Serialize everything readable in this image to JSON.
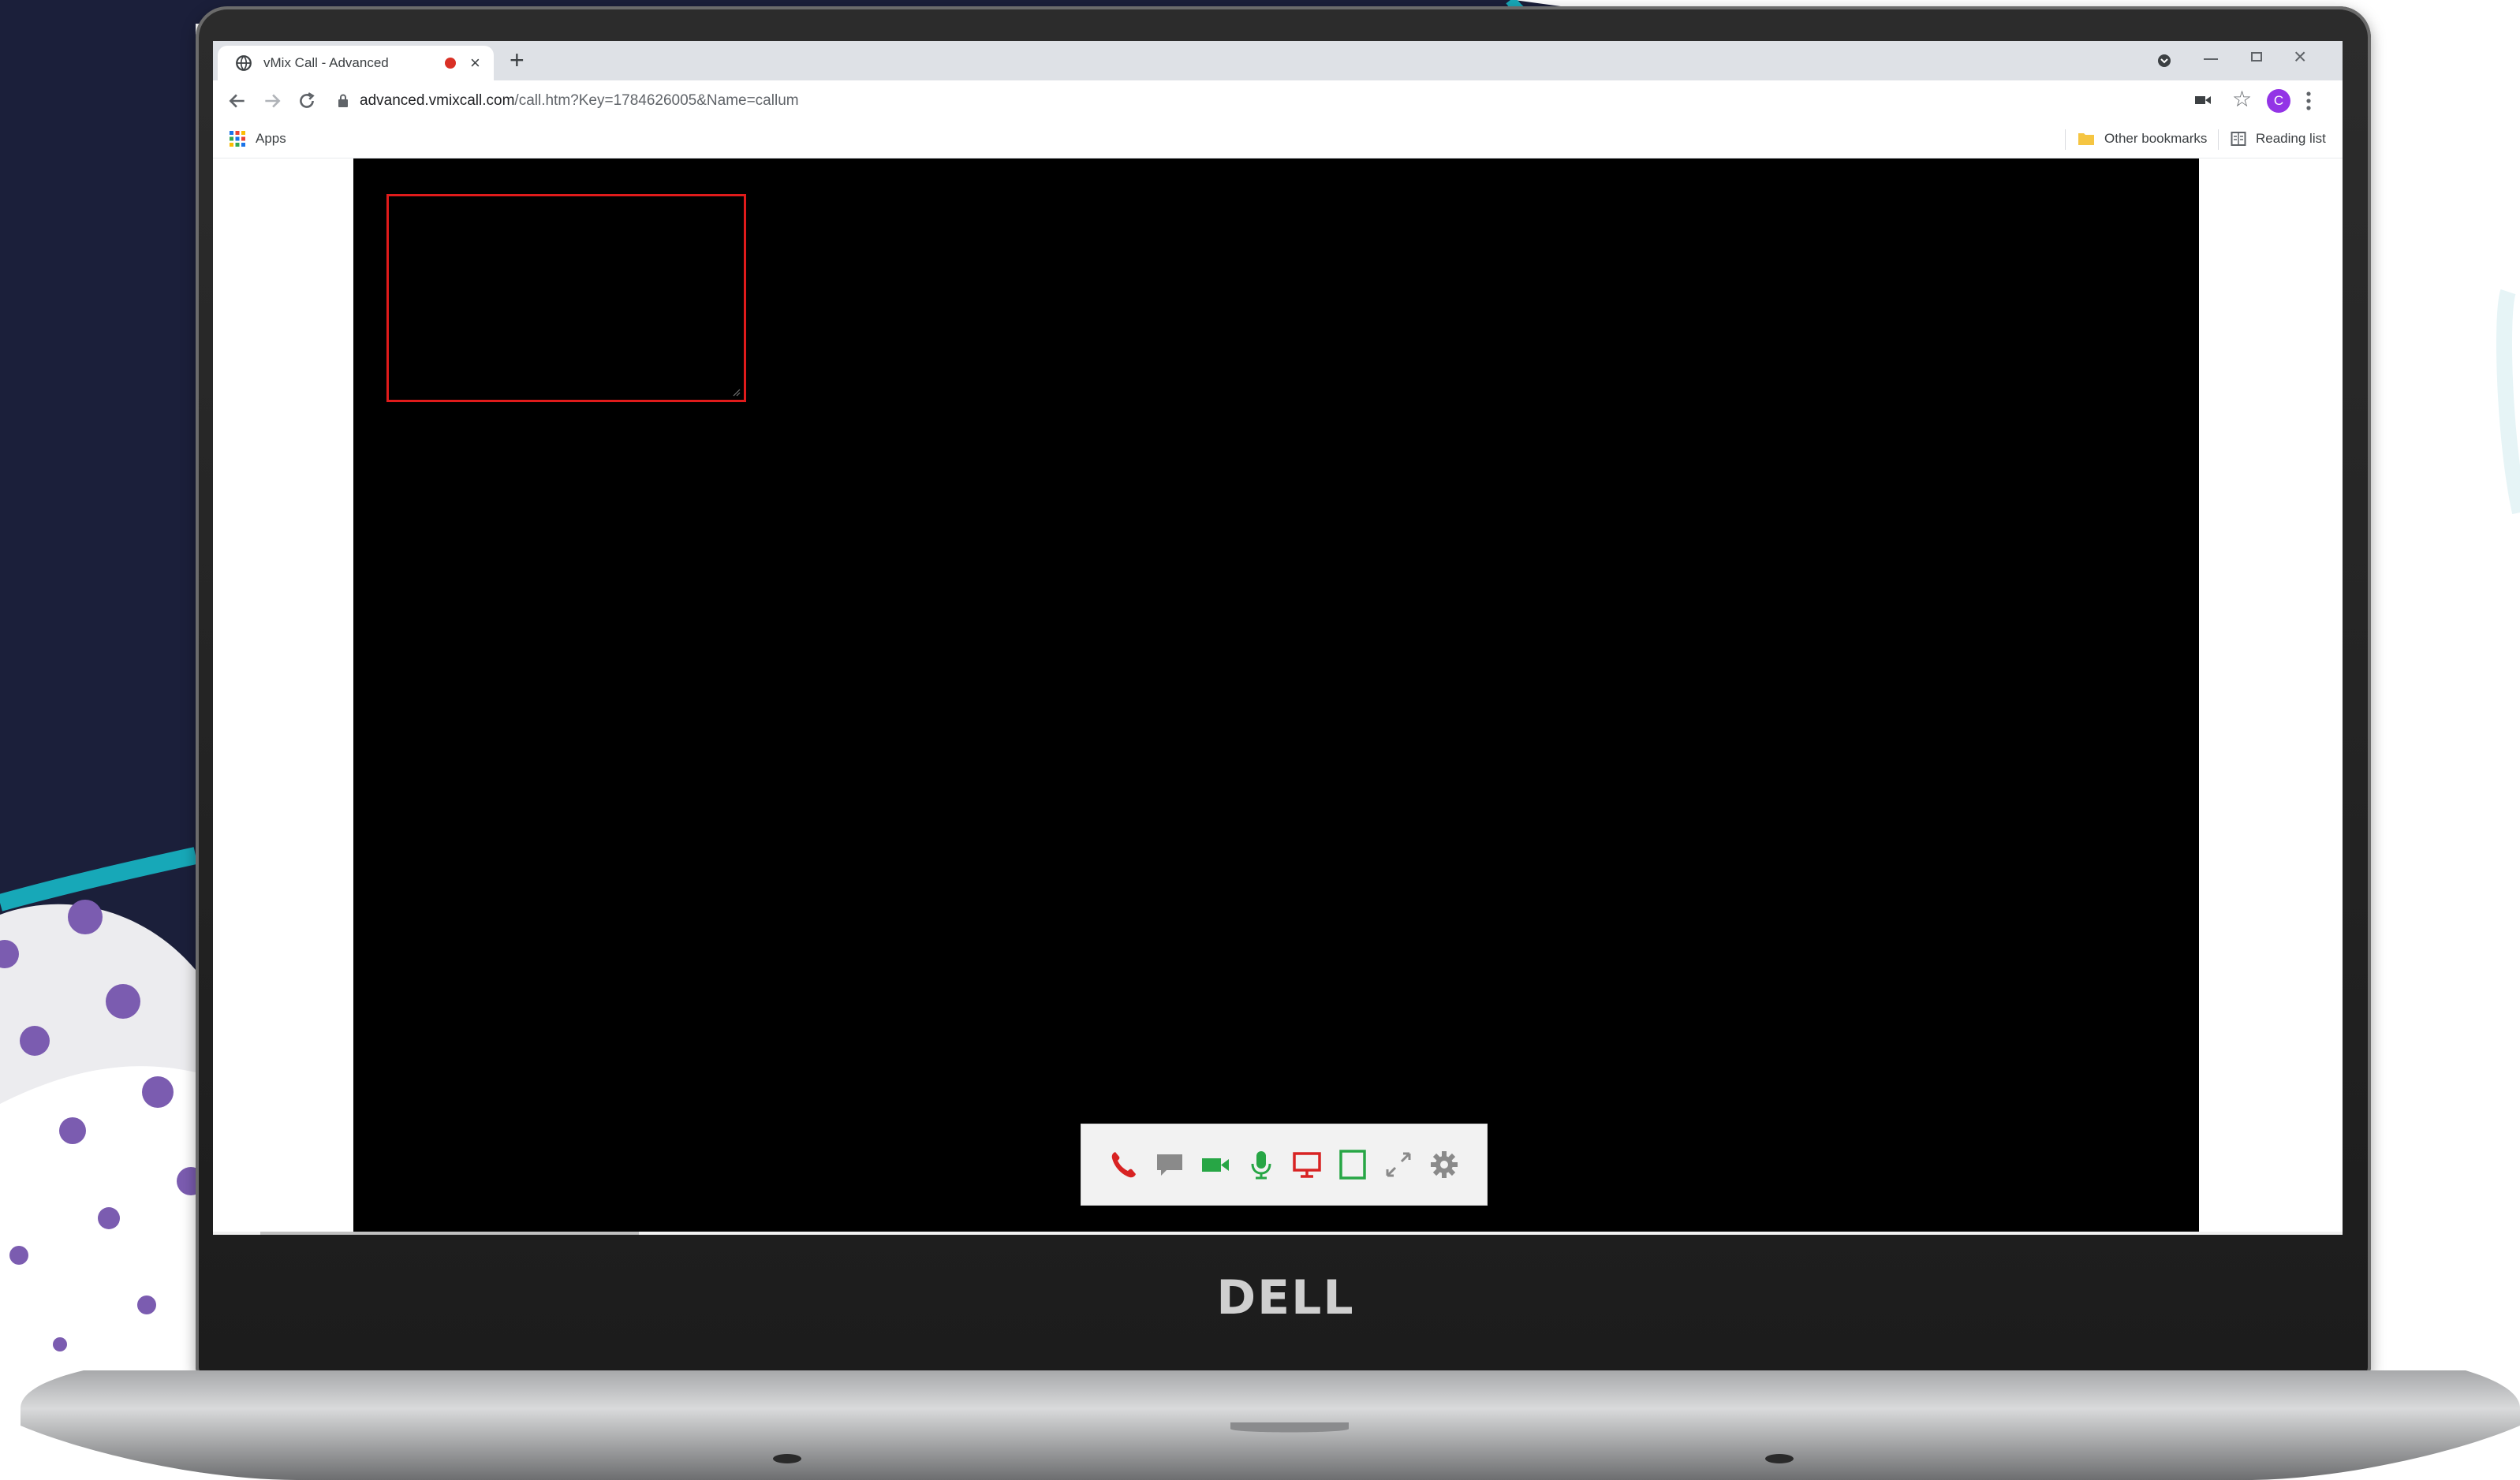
{
  "colors": {
    "background_navy": "#1b1f3a",
    "accent_teal": "#17a8b8",
    "dots_purple": "#7b5cb0",
    "preview_border": "#e01b1b",
    "hangup_red": "#d82323",
    "active_green": "#27a645",
    "screenshare_red": "#d82323",
    "muted_gray": "#8a8a8a"
  },
  "browser": {
    "tab": {
      "title": "vMix Call - Advanced",
      "favicon": "globe-icon",
      "recording_indicator": "record-icon",
      "close_icon": "close-icon"
    },
    "new_tab_icon": "plus-icon",
    "address": {
      "host": "advanced.vmixcall.com",
      "path": "/call.htm?Key=1784626005&Name=callum"
    },
    "profile_initial": "C",
    "bookmarks": {
      "apps_label": "Apps",
      "other_label": "Other bookmarks",
      "reading_label": "Reading list"
    }
  },
  "call": {
    "controls": [
      {
        "name": "hangup-icon",
        "state": "red"
      },
      {
        "name": "chat-icon",
        "state": "gray"
      },
      {
        "name": "camera-icon",
        "state": "green"
      },
      {
        "name": "microphone-icon",
        "state": "green"
      },
      {
        "name": "screen-share-icon",
        "state": "red"
      },
      {
        "name": "layout-icon",
        "state": "green"
      },
      {
        "name": "fullscreen-icon",
        "state": "gray"
      },
      {
        "name": "settings-icon",
        "state": "gray"
      }
    ]
  },
  "laptop": {
    "brand": "DELL"
  }
}
